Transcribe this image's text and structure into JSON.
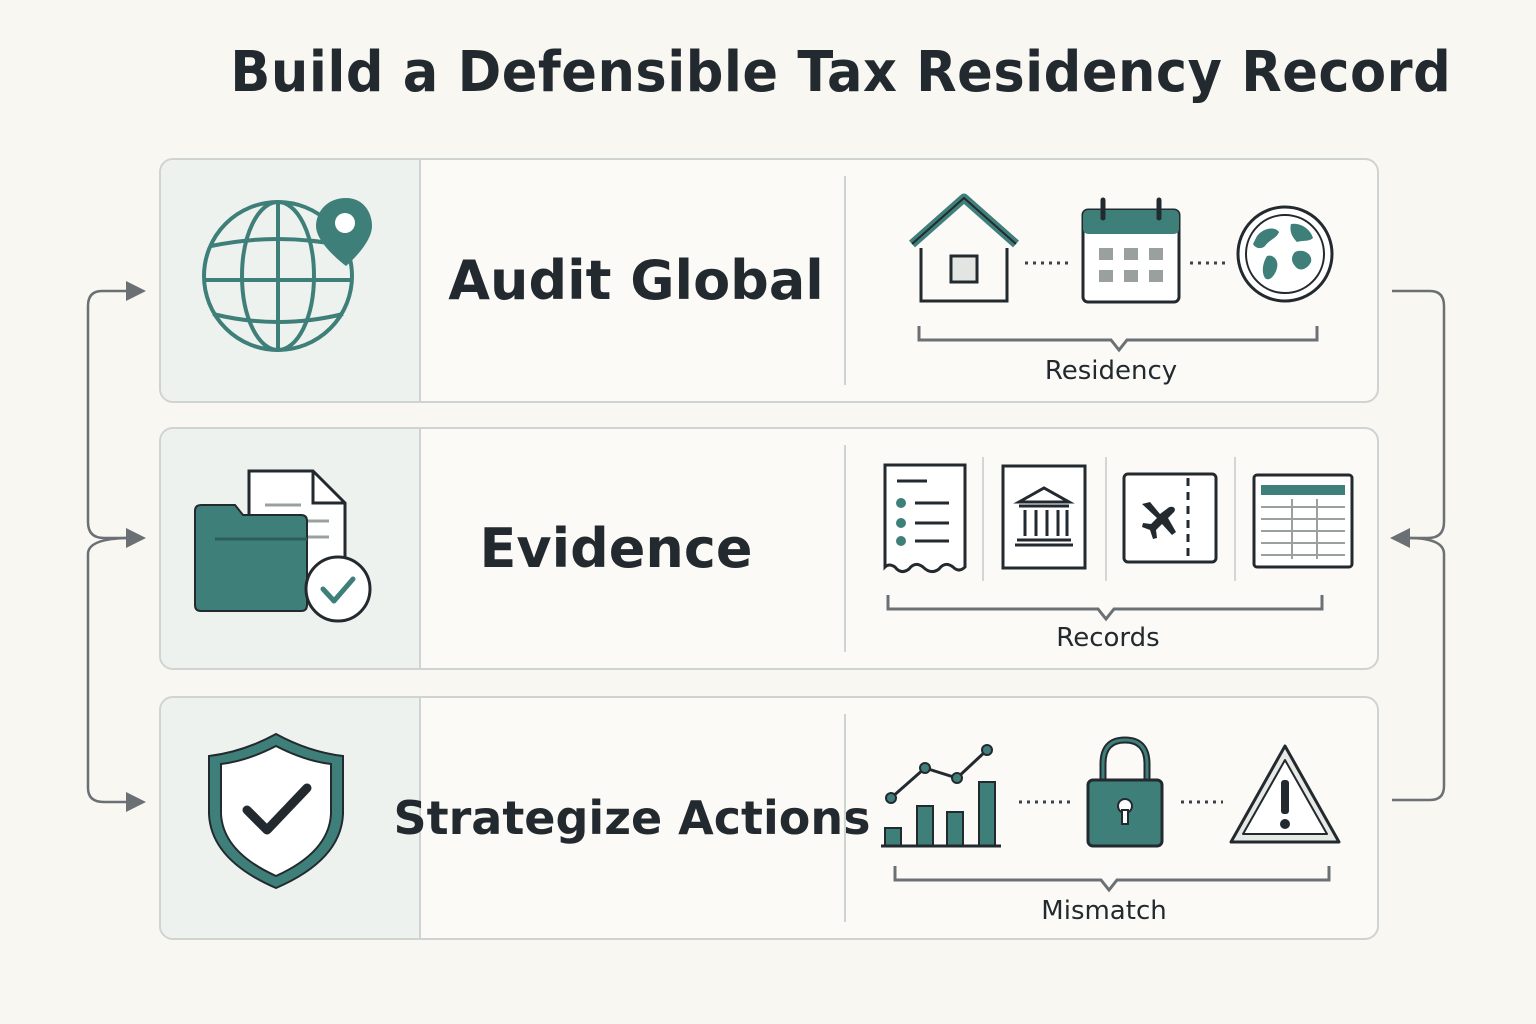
{
  "title": "Build a Defensible Tax Residency Record",
  "rows": [
    {
      "label": "Audit Global",
      "icon": "globe-location-icon",
      "caption": "Residency",
      "items": [
        "house-icon",
        "calendar-icon",
        "earth-icon"
      ]
    },
    {
      "label": "Evidence",
      "icon": "folder-document-check-icon",
      "caption": "Records",
      "items": [
        "receipt-list-icon",
        "bank-icon",
        "boarding-pass-icon",
        "spreadsheet-icon"
      ]
    },
    {
      "label": "Strategize Actions",
      "icon": "shield-check-icon",
      "caption": "Mismatch",
      "items": [
        "chart-icon",
        "padlock-icon",
        "warning-icon"
      ]
    }
  ],
  "colors": {
    "accent": "#3f7f79",
    "ink": "#232a2f",
    "panel_border": "#cfd3d1",
    "icon_bg": "#eef2ee",
    "background": "#f8f7f2"
  }
}
